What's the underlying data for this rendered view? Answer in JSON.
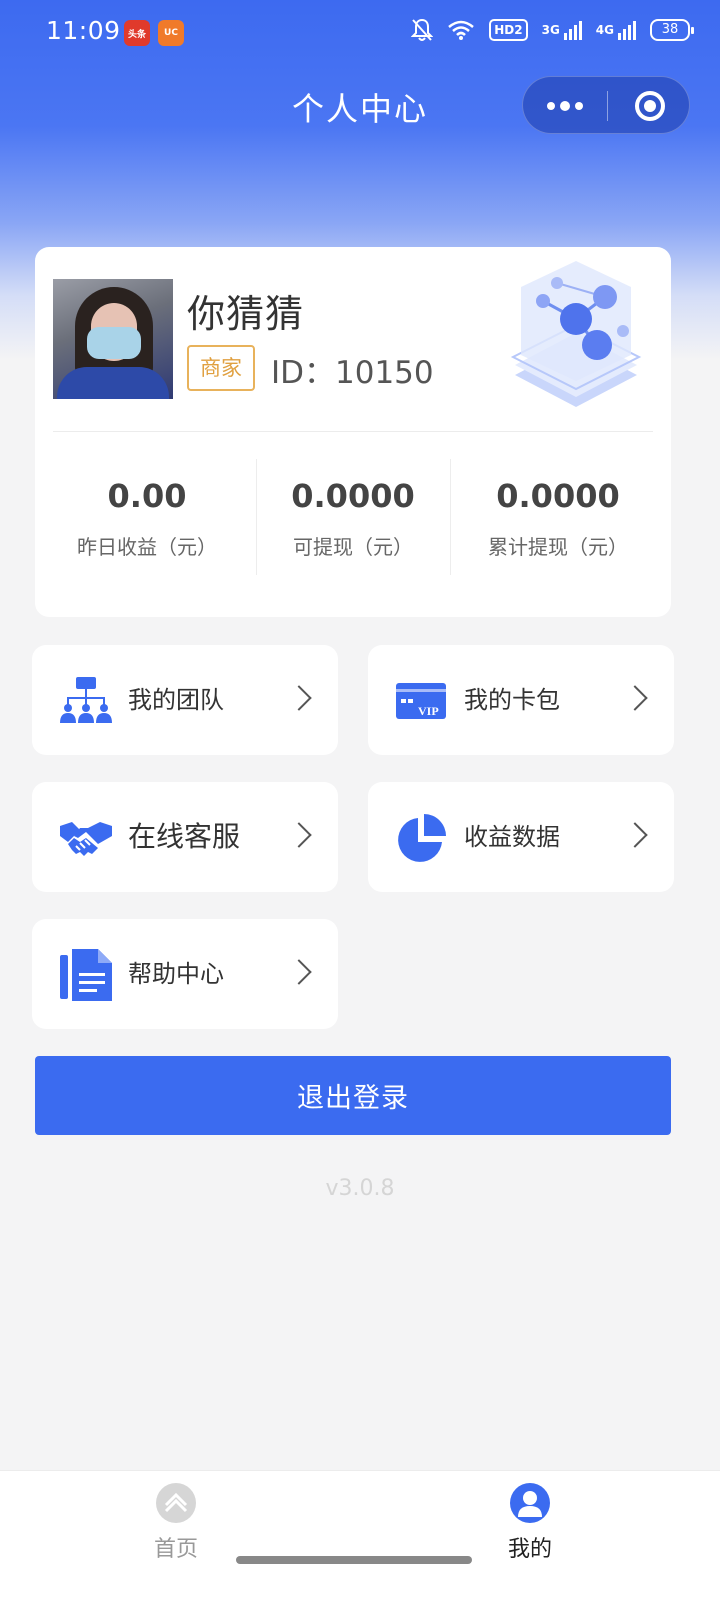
{
  "status_bar": {
    "time": "11:09",
    "app_badges": [
      "头条",
      "UC"
    ],
    "hd_label": "HD2",
    "network_a": "3G",
    "network_b": "4G",
    "battery": "38"
  },
  "nav": {
    "title": "个人中心"
  },
  "profile": {
    "name": "你猜猜",
    "role_badge": "商家",
    "id_text": "ID：10150"
  },
  "stats": [
    {
      "value": "0.00",
      "label": "昨日收益（元）"
    },
    {
      "value": "0.0000",
      "label": "可提现（元）"
    },
    {
      "value": "0.0000",
      "label": "累计提现（元）"
    }
  ],
  "menu": {
    "team": "我的团队",
    "card_pack": "我的卡包",
    "vip_text": "VIP",
    "online_service": "在线客服",
    "earnings_data": "收益数据",
    "help_center": "帮助中心"
  },
  "logout_label": "退出登录",
  "version": "v3.0.8",
  "tabs": {
    "home": "首页",
    "mine": "我的"
  },
  "colors": {
    "primary": "#3b6bf0",
    "badge": "#e8b25b"
  }
}
